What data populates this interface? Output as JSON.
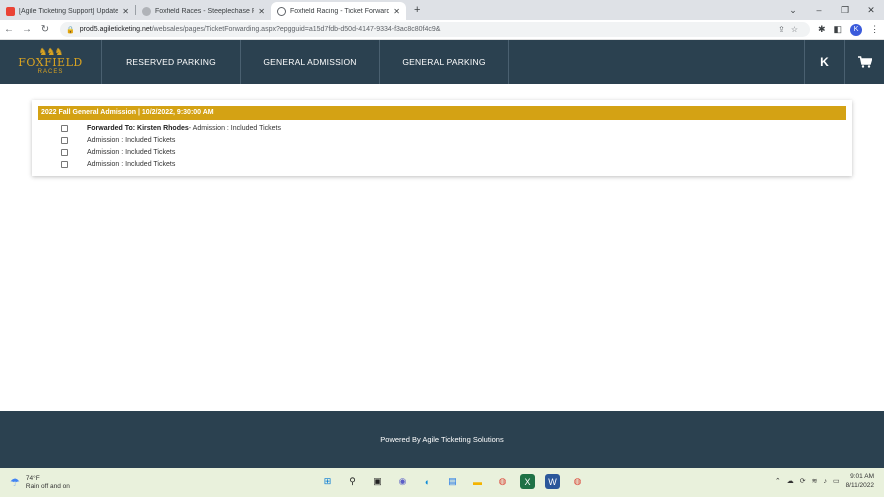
{
  "browser": {
    "tabs": [
      {
        "title": "[Agile Ticketing Support] Update",
        "favicon_color": "#ea4335",
        "active": false
      },
      {
        "title": "Foxfield Races - Steeplechase Ra",
        "favicon_color": "#5f6368",
        "active": false
      },
      {
        "title": "Foxfield Racing - Ticket Forward",
        "favicon_color": "#5f6368",
        "active": true
      }
    ],
    "new_tab": "+",
    "url_host": "prod5.agileticketing.net",
    "url_path": "/websales/pages/TicketForwarding.aspx?epgguid=a15d7fdb-d50d-4147-9334-f3ac8c80f4c9&",
    "profile_initial": "K"
  },
  "site": {
    "logo_text": "FOXFIELD",
    "logo_sub": "RACES",
    "nav": [
      {
        "label": "RESERVED PARKING"
      },
      {
        "label": "GENERAL ADMISSION"
      },
      {
        "label": "GENERAL PARKING"
      }
    ],
    "user_initial": "K",
    "cart_icon": "cart-icon"
  },
  "panel": {
    "title": "2022 Fall General Admission | 10/2/2022, 9:30:00 AM",
    "forwarded_label": "Forwarded To: Kirsten Rhodes",
    "forwarded_detail": " - Admission : Included Tickets",
    "tickets": [
      "Admission : Included Tickets",
      "Admission : Included Tickets",
      "Admission : Included Tickets"
    ]
  },
  "footer": {
    "text": "Powered By Agile Ticketing Solutions"
  },
  "taskbar": {
    "temperature": "74°F",
    "weather": "Rain off and on",
    "time": "9:01 AM",
    "date": "8/11/2022"
  },
  "colors": {
    "header_bg": "#2b4150",
    "accent_gold": "#d4a214",
    "footer_bg": "#2b4150"
  }
}
